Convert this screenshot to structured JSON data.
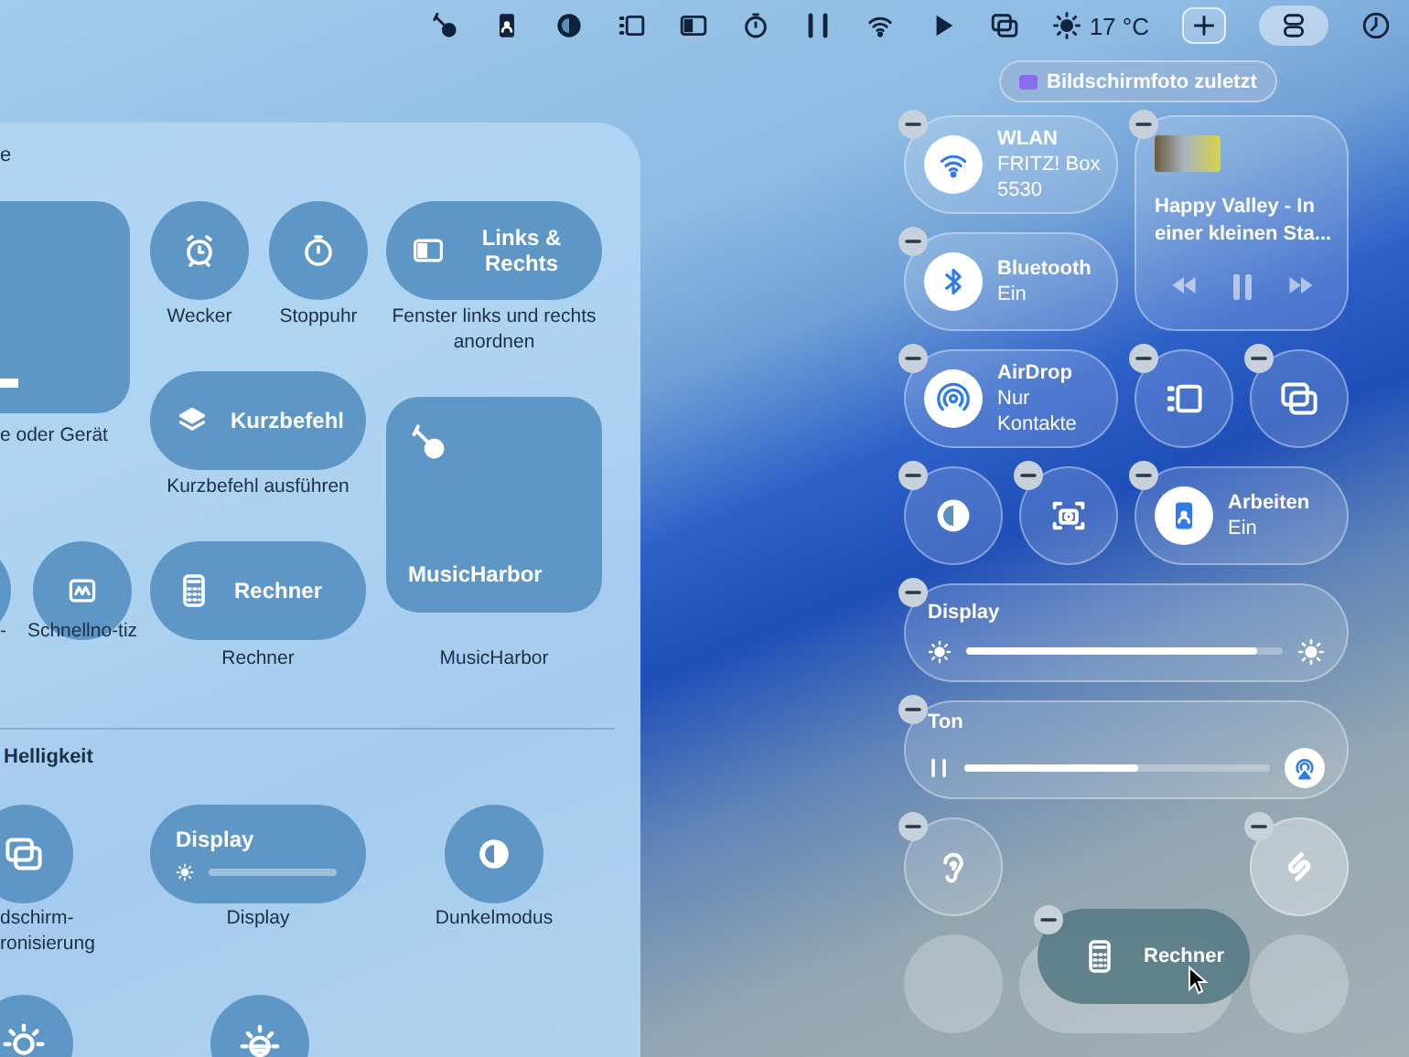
{
  "menu_bar": {
    "weather": "17 °C",
    "control_center_open": true
  },
  "screenshot_pill": {
    "label": "Bildschirmfoto zuletzt"
  },
  "gallery": {
    "heading": "e",
    "items": [
      {
        "kind": "big",
        "label": "e oder Gerät"
      },
      {
        "kind": "circle",
        "label": "Wecker"
      },
      {
        "kind": "circle",
        "label": "Stoppuhr"
      },
      {
        "kind": "wide",
        "title": "Links & Rechts",
        "label": "Fenster links und rechts anordnen"
      },
      {
        "kind": "wide",
        "title": "Kurzbefehl",
        "label": "Kurzbefehl ausführen"
      },
      {
        "kind": "big",
        "title": "MusicHarbor",
        "label": "MusicHarbor"
      },
      {
        "kind": "circle",
        "label": "-"
      },
      {
        "kind": "circle",
        "label": "Schnellno-tiz"
      },
      {
        "kind": "wide",
        "title": "Rechner",
        "label": "Rechner"
      }
    ],
    "section_title": "Helligkeit",
    "section_items": [
      {
        "kind": "circle",
        "label": "dschirm-ronisierung"
      },
      {
        "kind": "slider",
        "title": "Display",
        "label": "Display"
      },
      {
        "kind": "circle",
        "label": "Dunkelmodus"
      },
      {
        "kind": "circle"
      },
      {
        "kind": "circle"
      }
    ]
  },
  "controls": [
    {
      "kind": "toggle",
      "title": "WLAN",
      "subtitle": "FRITZ! Box 5530",
      "on": true
    },
    {
      "kind": "media",
      "title": "Happy Valley - In einer kleinen Sta...",
      "playing": true
    },
    {
      "kind": "toggle",
      "title": "Bluetooth",
      "subtitle": "Ein",
      "on": true
    },
    {
      "kind": "toggle",
      "title": "AirDrop",
      "subtitle": "Nur Kontakte",
      "on": true
    },
    {
      "kind": "button"
    },
    {
      "kind": "button"
    },
    {
      "kind": "button"
    },
    {
      "kind": "button"
    },
    {
      "kind": "toggle",
      "title": "Arbeiten",
      "subtitle": "Ein",
      "on": true
    },
    {
      "kind": "slider",
      "title": "Display",
      "level": 0.92
    },
    {
      "kind": "slider",
      "title": "Ton",
      "level": 0.57
    },
    {
      "kind": "button"
    },
    {
      "kind": "empty"
    },
    {
      "kind": "button"
    },
    {
      "kind": "empty"
    },
    {
      "kind": "empty"
    },
    {
      "kind": "empty"
    }
  ],
  "dragged_tile": {
    "title": "Rechner"
  }
}
